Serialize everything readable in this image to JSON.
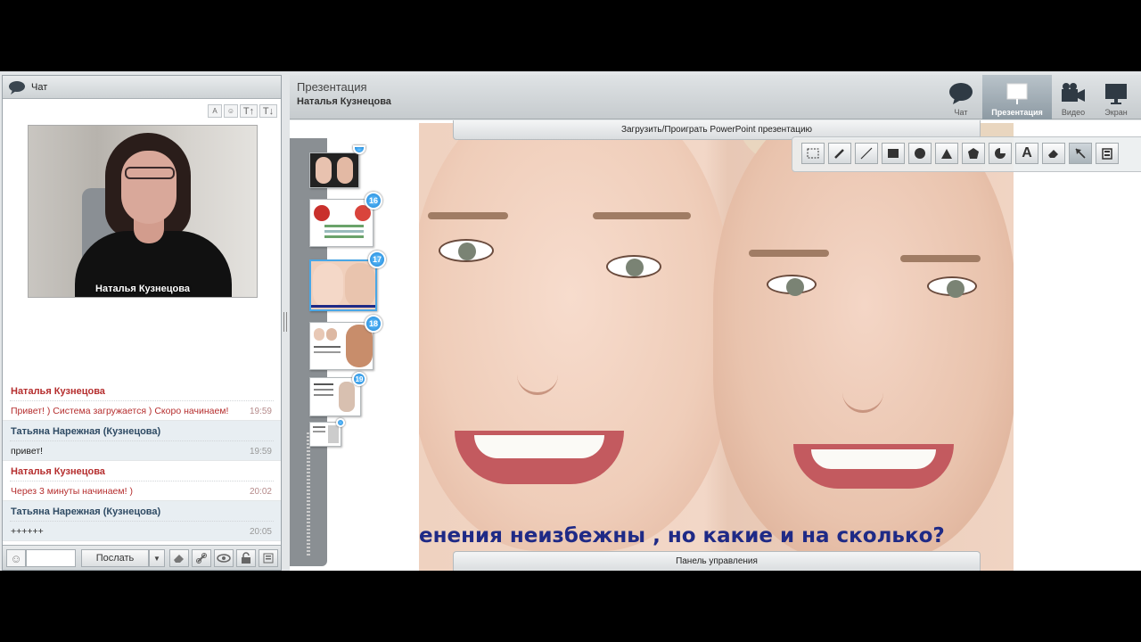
{
  "chat": {
    "title": "Чат",
    "video_name": "Наталья  Кузнецова",
    "font_tools": [
      "A",
      "☺",
      "T↑",
      "T↓"
    ],
    "messages": [
      {
        "author": "Наталья  Кузнецова",
        "text": "Привет! ) Система загружается ) Скоро начинаем!",
        "time": "19:59",
        "role": "a"
      },
      {
        "author": "Татьяна Нарежная (Кузнецова)",
        "text": "привет!",
        "time": "19:59",
        "role": "b"
      },
      {
        "author": "Наталья  Кузнецова",
        "text": "Через 3 минуты начинаем! )",
        "time": "20:02",
        "role": "a"
      },
      {
        "author": "Татьяна Нарежная (Кузнецова)",
        "text": "++++++",
        "time": "20:05",
        "role": "b"
      }
    ],
    "send_label": "Послать",
    "send_dropdown": "▼",
    "smile": "☺"
  },
  "presentation": {
    "title": "Презентация",
    "presenter": "Наталья  Кузнецова",
    "modes": [
      {
        "label": "Чат",
        "icon": "speech-bubble-icon"
      },
      {
        "label": "Презентация",
        "icon": "whiteboard-icon"
      },
      {
        "label": "Видео",
        "icon": "video-camera-icon"
      },
      {
        "label": "Экран",
        "icon": "monitor-icon"
      }
    ],
    "upload_label": "Загрузить/Проиграть PowerPoint презентацию",
    "control_label": "Панель управления",
    "caption": "енения неизбежны , но какие и на сколько?",
    "thumbnails": [
      {
        "number": "16"
      },
      {
        "number": "17"
      },
      {
        "number": "18"
      },
      {
        "number": "19"
      }
    ],
    "selected_thumbnail": "17",
    "draw_tools": [
      "select-rect-icon",
      "pencil-icon",
      "line-icon",
      "rectangle-icon",
      "circle-icon",
      "triangle-icon",
      "pentagon-icon",
      "pie-icon",
      "text-icon",
      "eraser-icon",
      "pointer-icon",
      "save-icon"
    ],
    "text_tool_glyph": "A",
    "accent_color": "#4aa7e6",
    "caption_color": "#1f2a86"
  }
}
